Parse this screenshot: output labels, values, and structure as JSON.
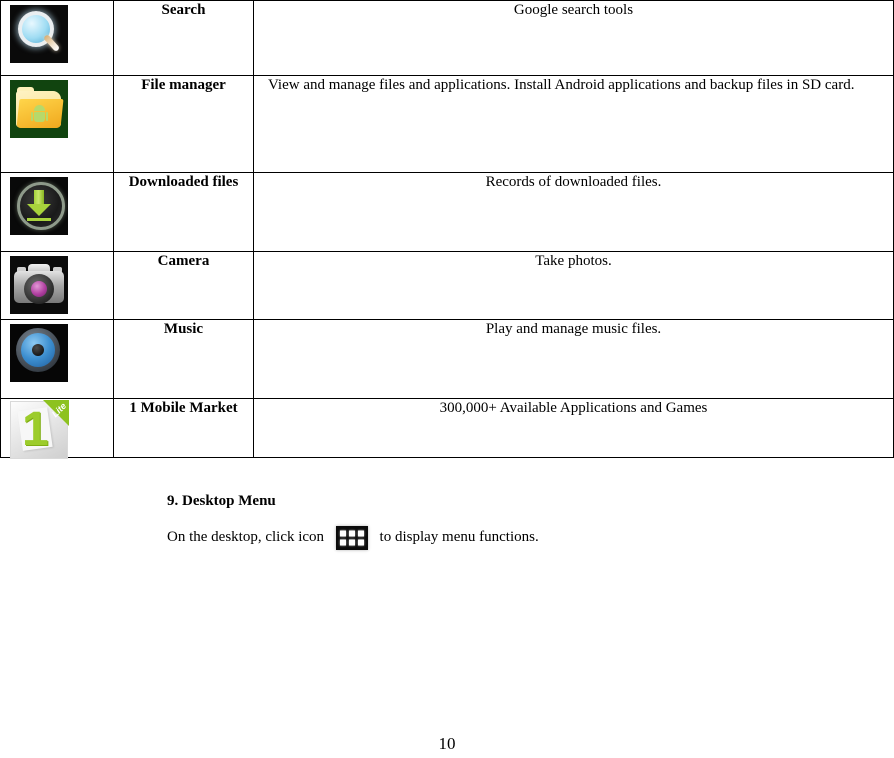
{
  "document": {
    "page_number": "10"
  },
  "table": {
    "rows": [
      {
        "icon": "search-icon",
        "name": "Search",
        "description": "Google search tools",
        "align": "center"
      },
      {
        "icon": "folder-icon",
        "name": "File manager",
        "description": "View and manage files and applications. Install Android applications and backup files in SD card.",
        "align": "left"
      },
      {
        "icon": "download-icon",
        "name": "Downloaded files",
        "description": "Records of downloaded files.",
        "align": "center"
      },
      {
        "icon": "camera-icon",
        "name": "Camera",
        "description": "Take photos.",
        "align": "center"
      },
      {
        "icon": "music-icon",
        "name": "Music",
        "description": "Play and manage music files.",
        "align": "center"
      },
      {
        "icon": "market-icon",
        "name": "1 Mobile Market",
        "description": "300,000+ Available Applications and Games",
        "align": "center"
      }
    ]
  },
  "section": {
    "heading": "9. Desktop Menu",
    "text_before_icon": "On the desktop, click icon ",
    "icon": "app-drawer-icon",
    "text_after_icon": " to display menu functions."
  },
  "icons": {
    "market_badge": "Lite",
    "market_digit": "1"
  },
  "colors": {
    "border": "#000000",
    "text": "#000000",
    "background": "#ffffff",
    "market_green": "#8dc21f",
    "download_green": "#a8d43c",
    "camera_lens": "#b03fa0",
    "music_blue": "#3d8fd0",
    "folder_yellow": "#f0a81e",
    "folder_bg": "#11440f"
  }
}
